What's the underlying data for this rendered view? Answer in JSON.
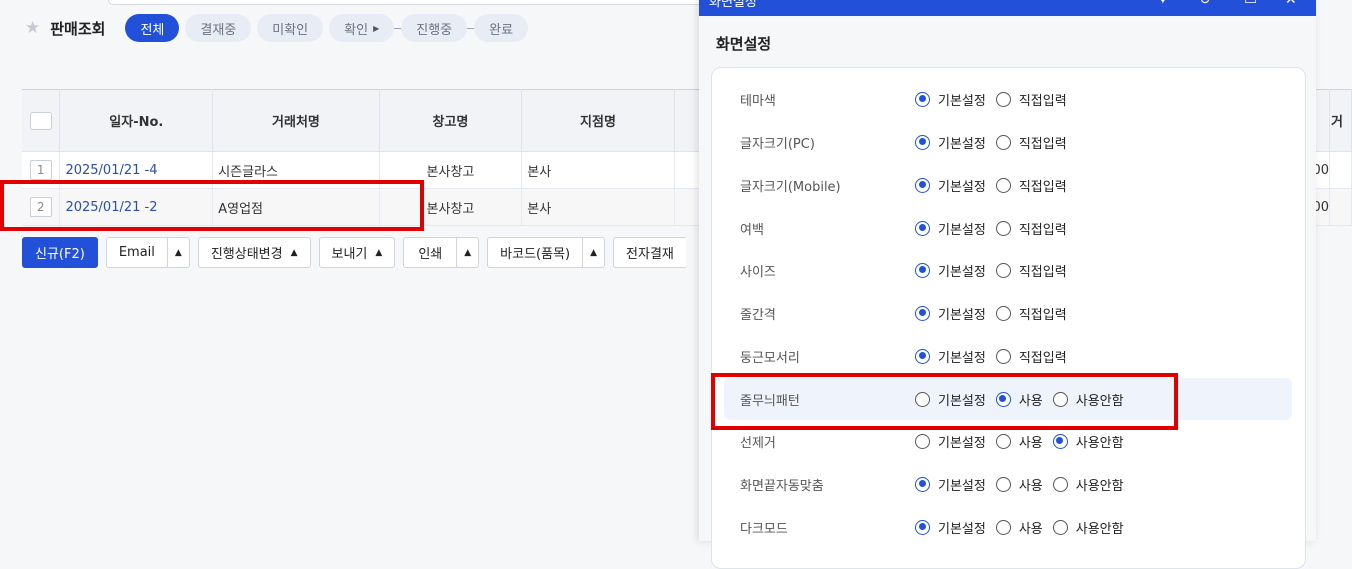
{
  "header": {
    "page_title": "판매조회",
    "filters": [
      {
        "label": "전체",
        "active": true
      },
      {
        "label": "결재중",
        "active": false
      },
      {
        "label": "미확인",
        "active": false
      },
      {
        "label": "확인",
        "active": false,
        "has_caret": true
      },
      {
        "label": "진행중",
        "active": false
      },
      {
        "label": "완료",
        "active": false
      }
    ]
  },
  "table": {
    "columns": [
      "일자-No.",
      "거래처명",
      "창고명",
      "지점명"
    ],
    "rows": [
      {
        "num": "1",
        "date_no": "2025/01/21 -4",
        "customer": "시즌글라스",
        "warehouse": "본사창고",
        "branch": "본사",
        "tail": "00"
      },
      {
        "num": "2",
        "date_no": "2025/01/21 -2",
        "customer": "A영업점",
        "warehouse": "본사창고",
        "branch": "본사",
        "tail": "00"
      }
    ],
    "right_header_fragment": "거"
  },
  "actions": {
    "new": "신규(F2)",
    "email": "Email",
    "status_change": "진행상태변경",
    "send": "보내기",
    "print": "인쇄",
    "barcode": "바코드(품목)",
    "e_approval": "전자결재"
  },
  "overlay": {
    "title": "화면설정",
    "section_title": "화면설정",
    "settings": [
      {
        "label": "테마색",
        "options": [
          "기본설정",
          "직접입력"
        ],
        "selected": 0
      },
      {
        "label": "글자크기(PC)",
        "options": [
          "기본설정",
          "직접입력"
        ],
        "selected": 0
      },
      {
        "label": "글자크기(Mobile)",
        "options": [
          "기본설정",
          "직접입력"
        ],
        "selected": 0
      },
      {
        "label": "여백",
        "options": [
          "기본설정",
          "직접입력"
        ],
        "selected": 0
      },
      {
        "label": "사이즈",
        "options": [
          "기본설정",
          "직접입력"
        ],
        "selected": 0
      },
      {
        "label": "줄간격",
        "options": [
          "기본설정",
          "직접입력"
        ],
        "selected": 0
      },
      {
        "label": "둥근모서리",
        "options": [
          "기본설정",
          "직접입력"
        ],
        "selected": 0
      },
      {
        "label": "줄무늬패턴",
        "options": [
          "기본설정",
          "사용",
          "사용안함"
        ],
        "selected": 1
      },
      {
        "label": "선제거",
        "options": [
          "기본설정",
          "사용",
          "사용안함"
        ],
        "selected": 2
      },
      {
        "label": "화면끝자동맞춤",
        "options": [
          "기본설정",
          "사용",
          "사용안함"
        ],
        "selected": 0
      },
      {
        "label": "다크모드",
        "options": [
          "기본설정",
          "사용",
          "사용안함"
        ],
        "selected": 0
      }
    ]
  },
  "colors": {
    "accent": "#2250d8",
    "highlight": "#e10000"
  }
}
